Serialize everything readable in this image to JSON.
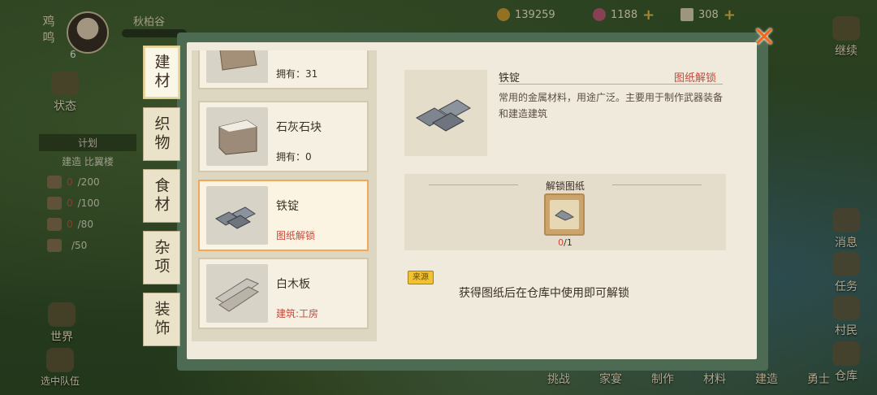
{
  "hud": {
    "rooster_label": "鸡鸣",
    "level": "6",
    "village": "秋柏谷",
    "coins": "139259",
    "gems": "1188",
    "tickets": "308"
  },
  "side_left": {
    "status": "状态",
    "world": "世界",
    "team": "选中队伍"
  },
  "plan": {
    "title": "计划",
    "subtitle": "建造 比翼楼",
    "rows": [
      {
        "cur": "0",
        "total": "/200"
      },
      {
        "cur": "0",
        "total": "/100"
      },
      {
        "cur": "0",
        "total": "/80"
      },
      {
        "cur": "",
        "total": "/50"
      }
    ]
  },
  "side_right": {
    "continue": "继续",
    "messages": "消息",
    "tasks": "任务",
    "villagers": "村民",
    "warehouse": "仓库"
  },
  "bottom": [
    "挑战",
    "家宴",
    "制作",
    "材料",
    "建造",
    "勇士"
  ],
  "tabs": [
    "建材",
    "织物",
    "食材",
    "杂项",
    "装饰"
  ],
  "items": [
    {
      "name": "",
      "sub": "拥有：31"
    },
    {
      "name": "石灰石块",
      "sub": "拥有：0"
    },
    {
      "name": "铁锭",
      "sub": "图纸解锁"
    },
    {
      "name": "白木板",
      "sub": "建筑:工房"
    }
  ],
  "detail": {
    "name": "铁锭",
    "tag": "图纸解锁",
    "desc": "常用的金属材料，用途广泛。主要用于制作武器装备和建造建筑",
    "unlock_title": "解锁图纸",
    "unlock_cur": "0",
    "unlock_total": "/1",
    "source_label": "来源",
    "hint": "获得图纸后在仓库中使用即可解锁"
  },
  "colors": {
    "modal_frame": "#4d6b52",
    "panel": "#efeadb",
    "accent_red": "#c8483a",
    "close": "#f06a1f",
    "selected_border": "#f1a85b"
  }
}
